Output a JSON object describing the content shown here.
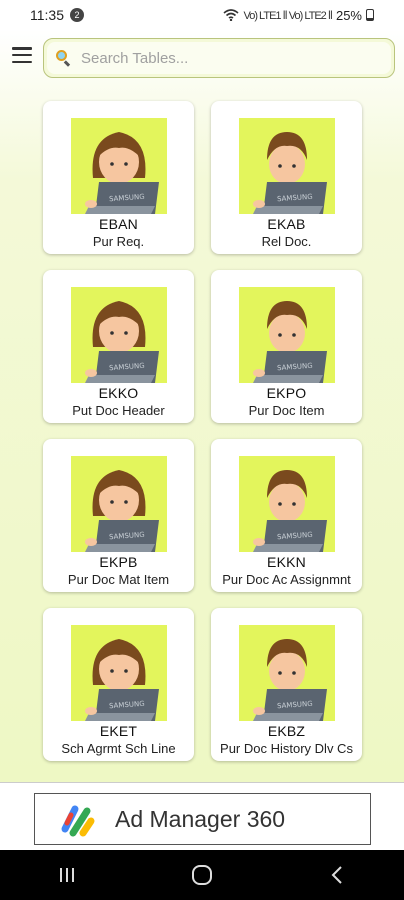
{
  "status_bar": {
    "time": "11:35",
    "notification_count": "2",
    "signal": "Vo) LTE1 ⅼⅼ Vo) LTE2 ⅼⅼ",
    "battery": "25%"
  },
  "search": {
    "placeholder": "Search Tables..."
  },
  "tables": [
    {
      "code": "EBAN",
      "desc": "Pur Req.",
      "avatar": "girl-laptop-icon"
    },
    {
      "code": "EKAB",
      "desc": "Rel Doc.",
      "avatar": "boy-laptop-icon"
    },
    {
      "code": "EKKO",
      "desc": "Put Doc Header",
      "avatar": "girl-laptop-icon"
    },
    {
      "code": "EKPO",
      "desc": "Pur Doc Item",
      "avatar": "boy-laptop-icon"
    },
    {
      "code": "EKPB",
      "desc": "Pur Doc Mat Item",
      "avatar": "girl-laptop-icon"
    },
    {
      "code": "EKKN",
      "desc": "Pur Doc Ac Assignmnt",
      "avatar": "boy-laptop-icon"
    },
    {
      "code": "EKET",
      "desc": "Sch Agrmt Sch Line",
      "avatar": "girl-laptop-icon"
    },
    {
      "code": "EKBZ",
      "desc": "Pur Doc History Dlv Cs",
      "avatar": "boy-laptop-icon"
    }
  ],
  "laptop_brand": "SAMSUNG",
  "ad": {
    "text": "Ad Manager 360"
  },
  "colors": {
    "thumb_bg": "#e3f55c",
    "app_bg": "#eef8c4",
    "laptop": "#5a6470"
  }
}
